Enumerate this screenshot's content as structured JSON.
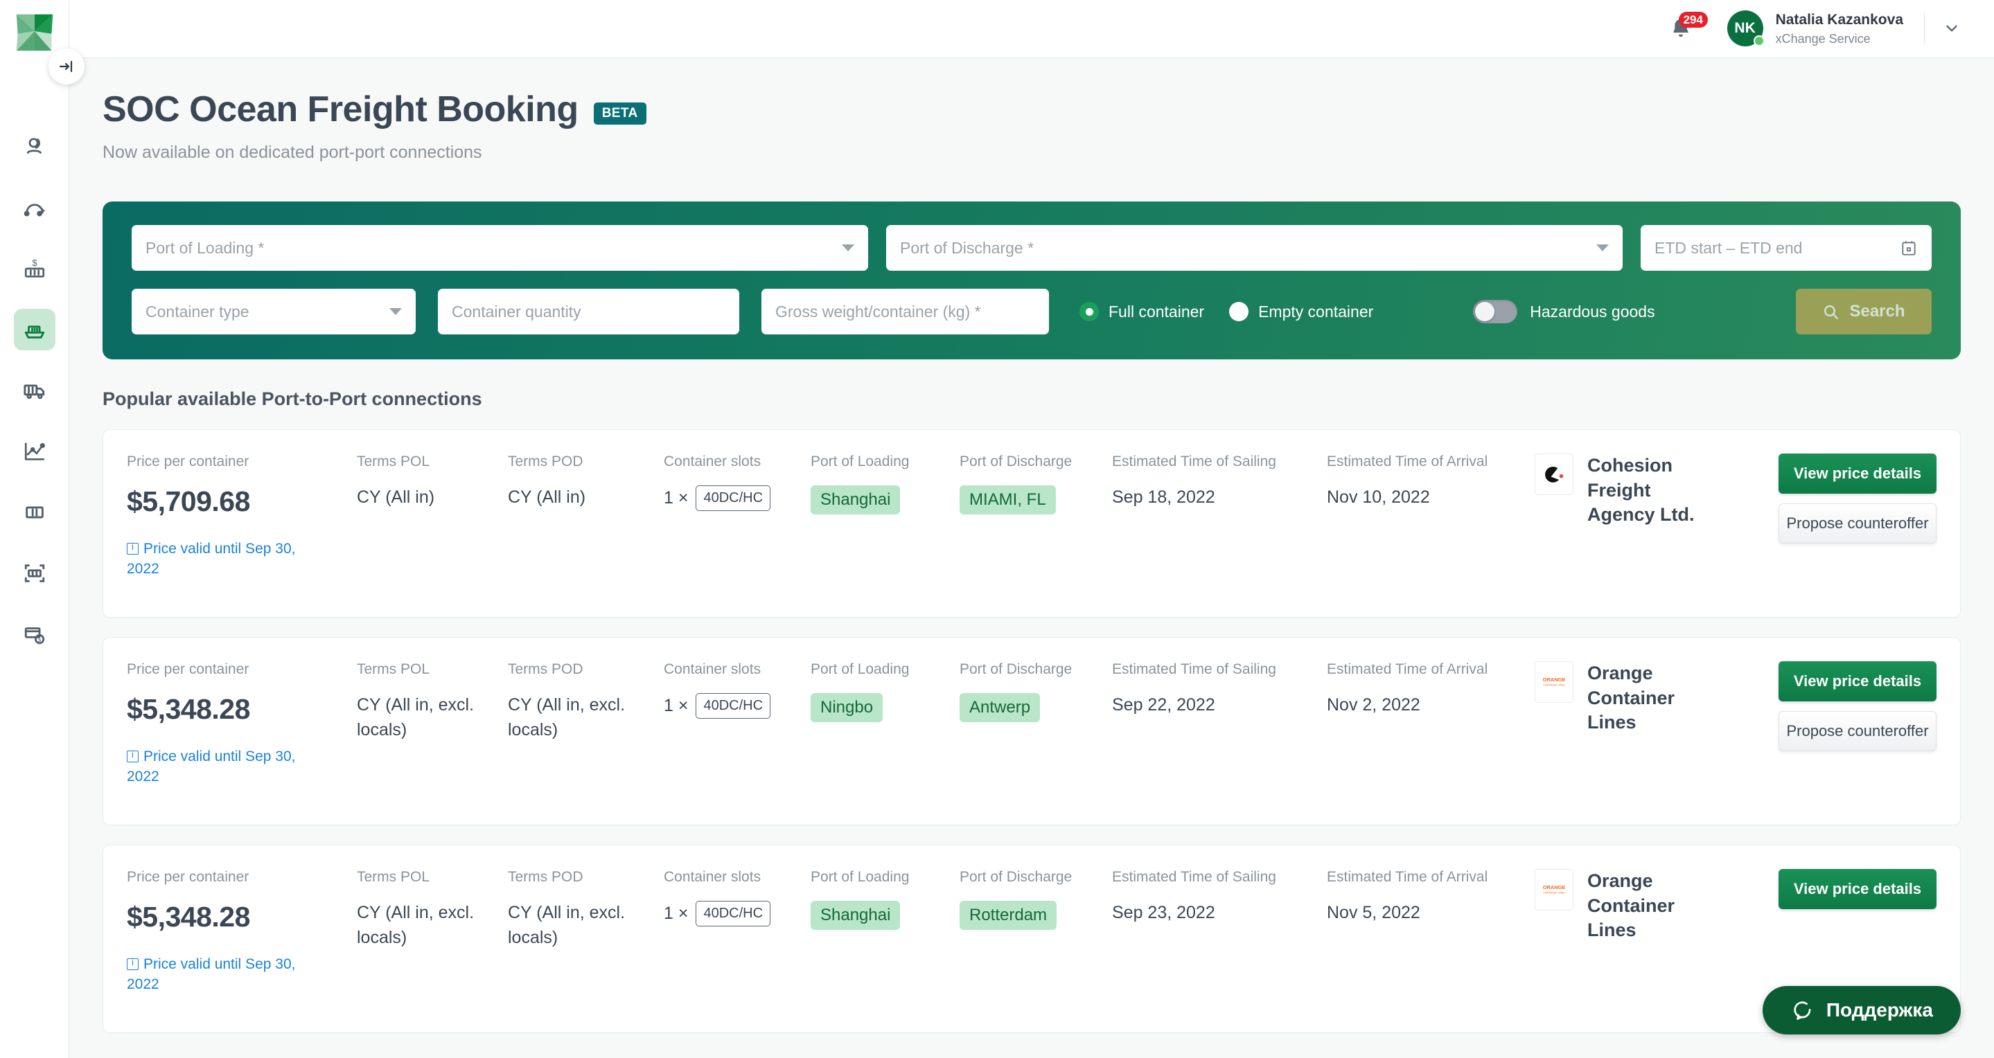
{
  "sidebar": {
    "logo_name": "xchange-logo",
    "collapse_label": "collapse-sidebar",
    "items": [
      {
        "icon": "search-loop-icon",
        "name": "sidebar-item-search",
        "active": false
      },
      {
        "icon": "one-way-route-icon",
        "name": "sidebar-item-one-way",
        "active": false
      },
      {
        "icon": "container-price-icon",
        "name": "sidebar-item-container-trading",
        "active": false
      },
      {
        "icon": "ship-icon",
        "name": "sidebar-item-ocean-freight",
        "active": true
      },
      {
        "icon": "truck-icon",
        "name": "sidebar-item-trucking",
        "active": false
      },
      {
        "icon": "analytics-icon",
        "name": "sidebar-item-insights",
        "active": false
      },
      {
        "icon": "container-icon",
        "name": "sidebar-item-containers",
        "active": false
      },
      {
        "icon": "container-scan-icon",
        "name": "sidebar-item-inspections",
        "active": false
      },
      {
        "icon": "card-payment-icon",
        "name": "sidebar-item-payments",
        "active": false
      }
    ]
  },
  "topbar": {
    "notification_count": "294",
    "user_initials": "NK",
    "user_name": "Natalia Kazankova",
    "user_org": "xChange Service"
  },
  "page": {
    "title": "SOC Ocean Freight Booking",
    "badge": "BETA",
    "subtitle": "Now available on dedicated port-port connections"
  },
  "search": {
    "port_of_loading_placeholder": "Port of Loading *",
    "port_of_discharge_placeholder": "Port of Discharge *",
    "etd_placeholder": "ETD start – ETD end",
    "container_type_placeholder": "Container type",
    "container_quantity_placeholder": "Container quantity",
    "gross_weight_placeholder": "Gross weight/container (kg) *",
    "radio_full": "Full container",
    "radio_empty": "Empty container",
    "radio_selected": "Full container",
    "hazardous_label": "Hazardous goods",
    "hazardous_on": false,
    "search_label": "Search",
    "gradient_from": "#0a6b63",
    "gradient_to": "#2a8a5c",
    "search_button_color": "#9aa055"
  },
  "results": {
    "section_title": "Popular available Port-to-Port connections",
    "column_labels": {
      "price": "Price per container",
      "terms_pol": "Terms POL",
      "terms_pod": "Terms POD",
      "slots": "Container slots",
      "pol": "Port of Loading",
      "pod": "Port of Discharge",
      "ets": "Estimated Time of Sailing",
      "eta": "Estimated Time of Arrival"
    },
    "actions": {
      "view_price_details": "View price details",
      "propose_counteroffer": "Propose counteroffer"
    },
    "rows": [
      {
        "price": "$5,709.68",
        "valid": "Price valid until Sep 30, 2022",
        "terms_pol": "CY (All in)",
        "terms_pod": "CY (All in)",
        "slot_qty": "1 ×",
        "slot_type": "40DC/HC",
        "pol": "Shanghai",
        "pod": "MIAMI, FL",
        "ets": "Sep 18, 2022",
        "eta": "Nov 10, 2022",
        "carrier": "Cohesion Freight Agency Ltd.",
        "carrier_logo": "cohesion-logo"
      },
      {
        "price": "$5,348.28",
        "valid": "Price valid until Sep 30, 2022",
        "terms_pol": "CY (All in, excl. locals)",
        "terms_pod": "CY (All in, excl. locals)",
        "slot_qty": "1 ×",
        "slot_type": "40DC/HC",
        "pol": "Ningbo",
        "pod": "Antwerp",
        "ets": "Sep 22, 2022",
        "eta": "Nov 2, 2022",
        "carrier": "Orange Container Lines",
        "carrier_logo": "orange-logo"
      },
      {
        "price": "$5,348.28",
        "valid": "Price valid until Sep 30, 2022",
        "terms_pol": "CY (All in, excl. locals)",
        "terms_pod": "CY (All in, excl. locals)",
        "slot_qty": "1 ×",
        "slot_type": "40DC/HC",
        "pol": "Shanghai",
        "pod": "Rotterdam",
        "ets": "Sep 23, 2022",
        "eta": "Nov 5, 2022",
        "carrier": "Orange Container Lines",
        "carrier_logo": "orange-logo"
      }
    ]
  },
  "support": {
    "label": "Поддержка",
    "icon": "chat-bubble-icon"
  }
}
